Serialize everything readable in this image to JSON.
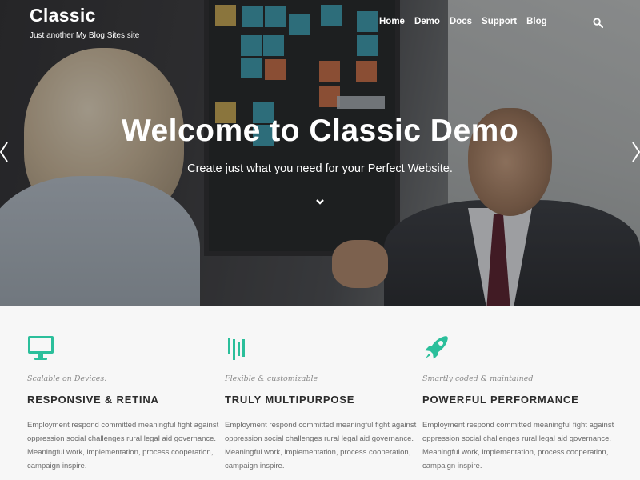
{
  "colors": {
    "accent": "#2bbf9b",
    "title_text": "#2b2b2b",
    "body_text": "#6b6b6b"
  },
  "header": {
    "site_title": "Classic",
    "tagline": "Just another My Blog Sites site",
    "nav": [
      "Home",
      "Demo",
      "Docs",
      "Support",
      "Blog"
    ],
    "search_icon": "search-icon"
  },
  "hero": {
    "title": "Welcome to Classic Demo",
    "subtitle": "Create just what you need for your Perfect Website.",
    "scroll_icon": "chevron-down-icon",
    "prev_icon": "chevron-left-icon",
    "next_icon": "chevron-right-icon"
  },
  "features": [
    {
      "icon": "monitor-icon",
      "kicker": "Scalable on Devices.",
      "title": "RESPONSIVE & RETINA",
      "desc": "Employment respond committed meaningful fight against oppression social challenges rural legal aid governance. Meaningful work, implementation, process cooperation, campaign inspire."
    },
    {
      "icon": "bars-icon",
      "kicker": "Flexible & customizable",
      "title": "TRULY MULTIPURPOSE",
      "desc": "Employment respond committed meaningful fight against oppression social challenges rural legal aid governance. Meaningful work, implementation, process cooperation, campaign inspire."
    },
    {
      "icon": "rocket-icon",
      "kicker": "Smartly coded & maintained",
      "title": "POWERFUL PERFORMANCE",
      "desc": "Employment respond committed meaningful fight against oppression social challenges rural legal aid governance. Meaningful work, implementation, process cooperation, campaign inspire."
    }
  ]
}
